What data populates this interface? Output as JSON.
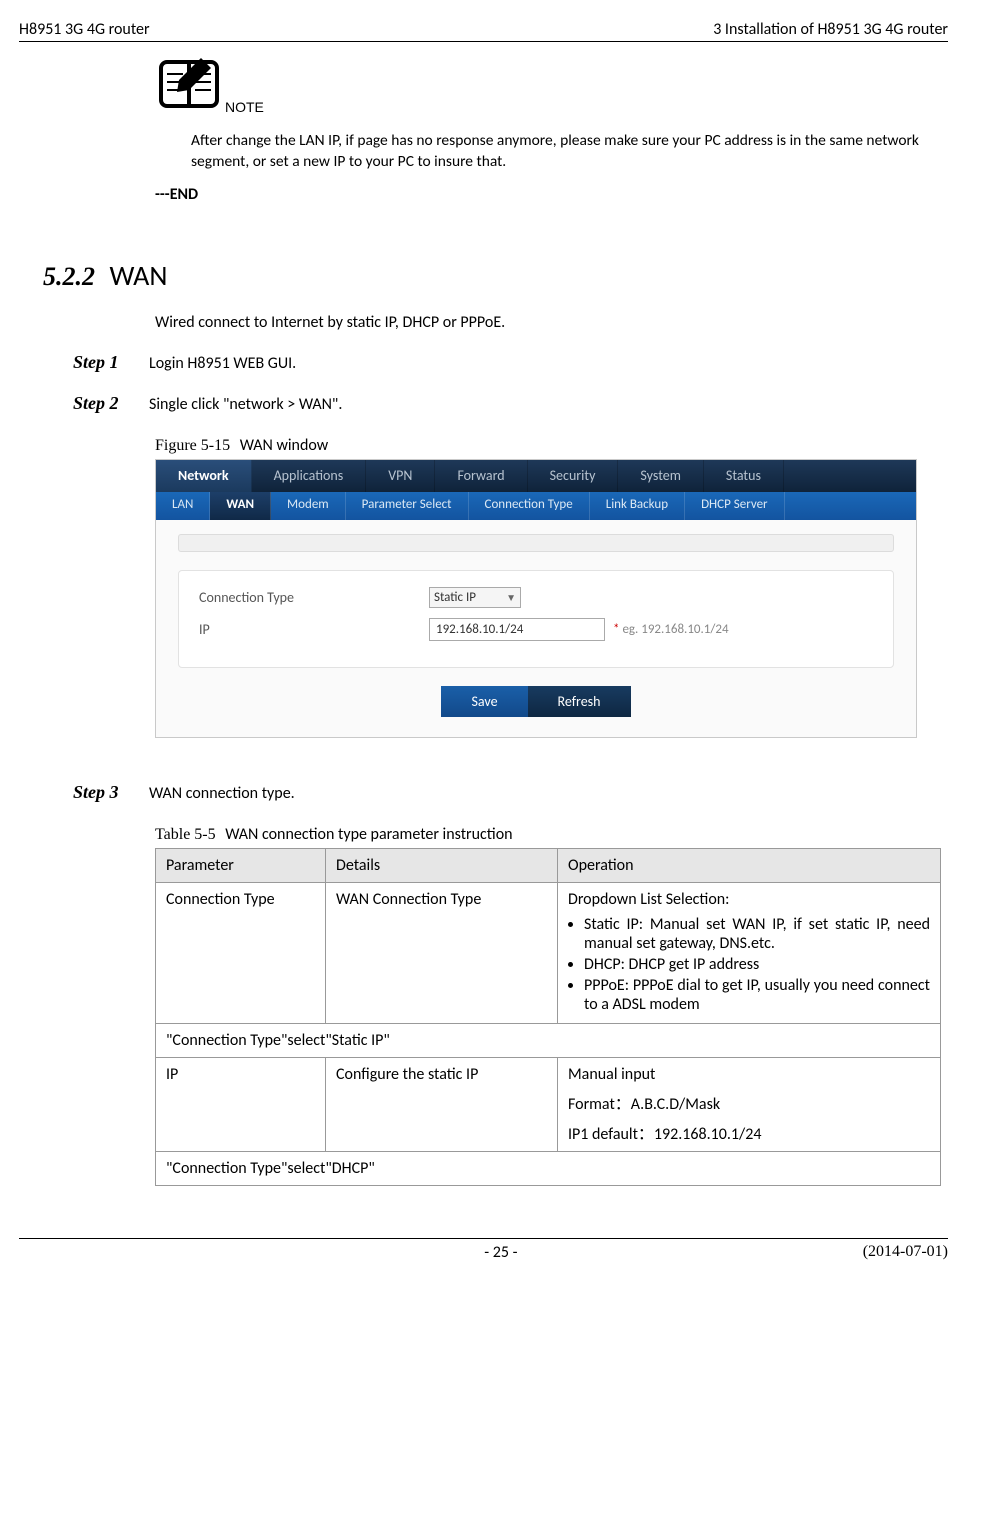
{
  "header": {
    "left": "H8951 3G 4G router",
    "right": "3  Installation of H8951 3G 4G router"
  },
  "note_text": "After change the LAN IP, if page has no response anymore, please make sure your PC address is in the same network segment, or set a new IP to your PC to insure that.",
  "end": "---END",
  "section": {
    "num": "5.2.2",
    "label": "WAN"
  },
  "intro": "Wired connect to Internet by static IP, DHCP or PPPoE.",
  "steps": {
    "s1_label": "Step 1",
    "s1_text": "Login H8951 WEB GUI.",
    "s2_label": "Step 2",
    "s2_text": "Single click \"network > WAN\".",
    "s3_label": "Step 3",
    "s3_text": "WAN connection type."
  },
  "figure": {
    "num": "Figure 5-15",
    "title": "WAN window"
  },
  "screenshot": {
    "tabs": [
      "Network",
      "Applications",
      "VPN",
      "Forward",
      "Security",
      "System",
      "Status"
    ],
    "subtabs": [
      "LAN",
      "WAN",
      "Modem",
      "Parameter Select",
      "Connection Type",
      "Link Backup",
      "DHCP Server"
    ],
    "connection_type_label": "Connection Type",
    "connection_type_value": "Static IP",
    "ip_label": "IP",
    "ip_value": "192.168.10.1/24",
    "hint_star": "*",
    "hint_text": "eg. 192.168.10.1/24",
    "save": "Save",
    "refresh": "Refresh"
  },
  "table": {
    "num": "Table 5-5",
    "title": "WAN connection type parameter instruction",
    "headers": [
      "Parameter",
      "Details",
      "Operation"
    ],
    "row1": {
      "param": "Connection Type",
      "details": "WAN Connection Type",
      "op_lead": "Dropdown List Selection:",
      "op_items": [
        "Static IP: Manual set WAN IP, if set static IP, need manual set gateway, DNS.etc.",
        "DHCP: DHCP get IP address",
        "PPPoE: PPPoE dial to get IP, usually you need connect to a ADSL modem"
      ]
    },
    "row2_full": "\"Connection Type\"select\"Static IP\"",
    "row3": {
      "param": "IP",
      "details": "Configure the static IP",
      "op_line1": "Manual input",
      "op_line2": "Format：A.B.C.D/Mask",
      "op_line3": "IP1 default：192.168.10.1/24"
    },
    "row4_full": "\"Connection Type\"select\"DHCP\""
  },
  "footer": {
    "page": "- 25 -",
    "date": "(2014-07-01)"
  }
}
